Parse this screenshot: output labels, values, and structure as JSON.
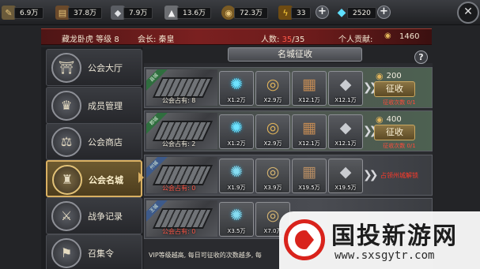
{
  "resources": [
    {
      "icon": "feather-icon",
      "value": "6.9万"
    },
    {
      "icon": "wood-icon",
      "value": "37.8万"
    },
    {
      "icon": "iron-icon",
      "value": "7.9万"
    },
    {
      "icon": "stone-icon",
      "value": "13.6万"
    },
    {
      "icon": "coin-icon",
      "value": "72.3万"
    },
    {
      "icon": "lightning-icon",
      "value": "33"
    },
    {
      "icon": "diamond-icon",
      "value": "2520"
    }
  ],
  "info": {
    "guild_name": "藏龙卧虎 等级 8",
    "leader": "会长: 秦皇",
    "members_label": "人数: ",
    "members_current": "35",
    "members_max": "/35",
    "contribution_label": "个人贡献:",
    "contribution_value": "1460"
  },
  "sidebar": {
    "items": [
      {
        "label": "公会大厅",
        "icon": "guild-hall-icon",
        "active": false
      },
      {
        "label": "成员管理",
        "icon": "member-management-icon",
        "active": false
      },
      {
        "label": "公会商店",
        "icon": "guild-shop-icon",
        "active": false
      },
      {
        "label": "公会名城",
        "icon": "famous-city-icon",
        "active": true
      },
      {
        "label": "战争记录",
        "icon": "war-record-icon",
        "active": false
      },
      {
        "label": "召集令",
        "icon": "summon-order-icon",
        "active": false
      }
    ]
  },
  "title": "名城征收",
  "cities": [
    {
      "ribbon": "县城",
      "occupied": "公会占有: 8",
      "rewards": [
        {
          "icon": "spirit-icon",
          "qty": "X1.2万"
        },
        {
          "icon": "coin-icon",
          "qty": "X2.9万"
        },
        {
          "icon": "wood-icon",
          "qty": "X12.1万"
        },
        {
          "icon": "iron-icon",
          "qty": "X12.1万"
        }
      ],
      "cost": "200",
      "button": "征收",
      "count": "征收次数 0/1",
      "lock_msg": ""
    },
    {
      "ribbon": "郡城",
      "occupied": "公会占有: 2",
      "rewards": [
        {
          "icon": "spirit-icon",
          "qty": "X1.2万"
        },
        {
          "icon": "coin-icon",
          "qty": "X2.9万"
        },
        {
          "icon": "wood-icon",
          "qty": "X12.1万"
        },
        {
          "icon": "iron-icon",
          "qty": "X12.1万"
        }
      ],
      "cost": "400",
      "button": "征收",
      "count": "征收次数 0/1",
      "lock_msg": ""
    },
    {
      "ribbon": "州城",
      "occupied": "公会占有: 0",
      "rewards": [
        {
          "icon": "spirit-icon",
          "qty": "X1.9万"
        },
        {
          "icon": "coin-icon",
          "qty": "X3.9万"
        },
        {
          "icon": "wood-icon",
          "qty": "X19.5万"
        },
        {
          "icon": "iron-icon",
          "qty": "X19.5万"
        }
      ],
      "cost": "",
      "button": "",
      "count": "",
      "lock_msg": "占领州城解锁"
    },
    {
      "ribbon": "王城",
      "occupied": "公会占有: 0",
      "rewards": [
        {
          "icon": "spirit-icon",
          "qty": "X3.5万"
        },
        {
          "icon": "coin-icon",
          "qty": "X7.0万"
        },
        {
          "icon": "wood-icon",
          "qty": ""
        },
        {
          "icon": "iron-icon",
          "qty": ""
        }
      ],
      "cost": "",
      "button": "",
      "count": "",
      "lock_msg": ""
    }
  ],
  "footnote": "VIP等级越高, 每日可征收的次数越多, 每",
  "watermark": {
    "name": "国投新游网",
    "url": "www.sxsgytr.com"
  }
}
